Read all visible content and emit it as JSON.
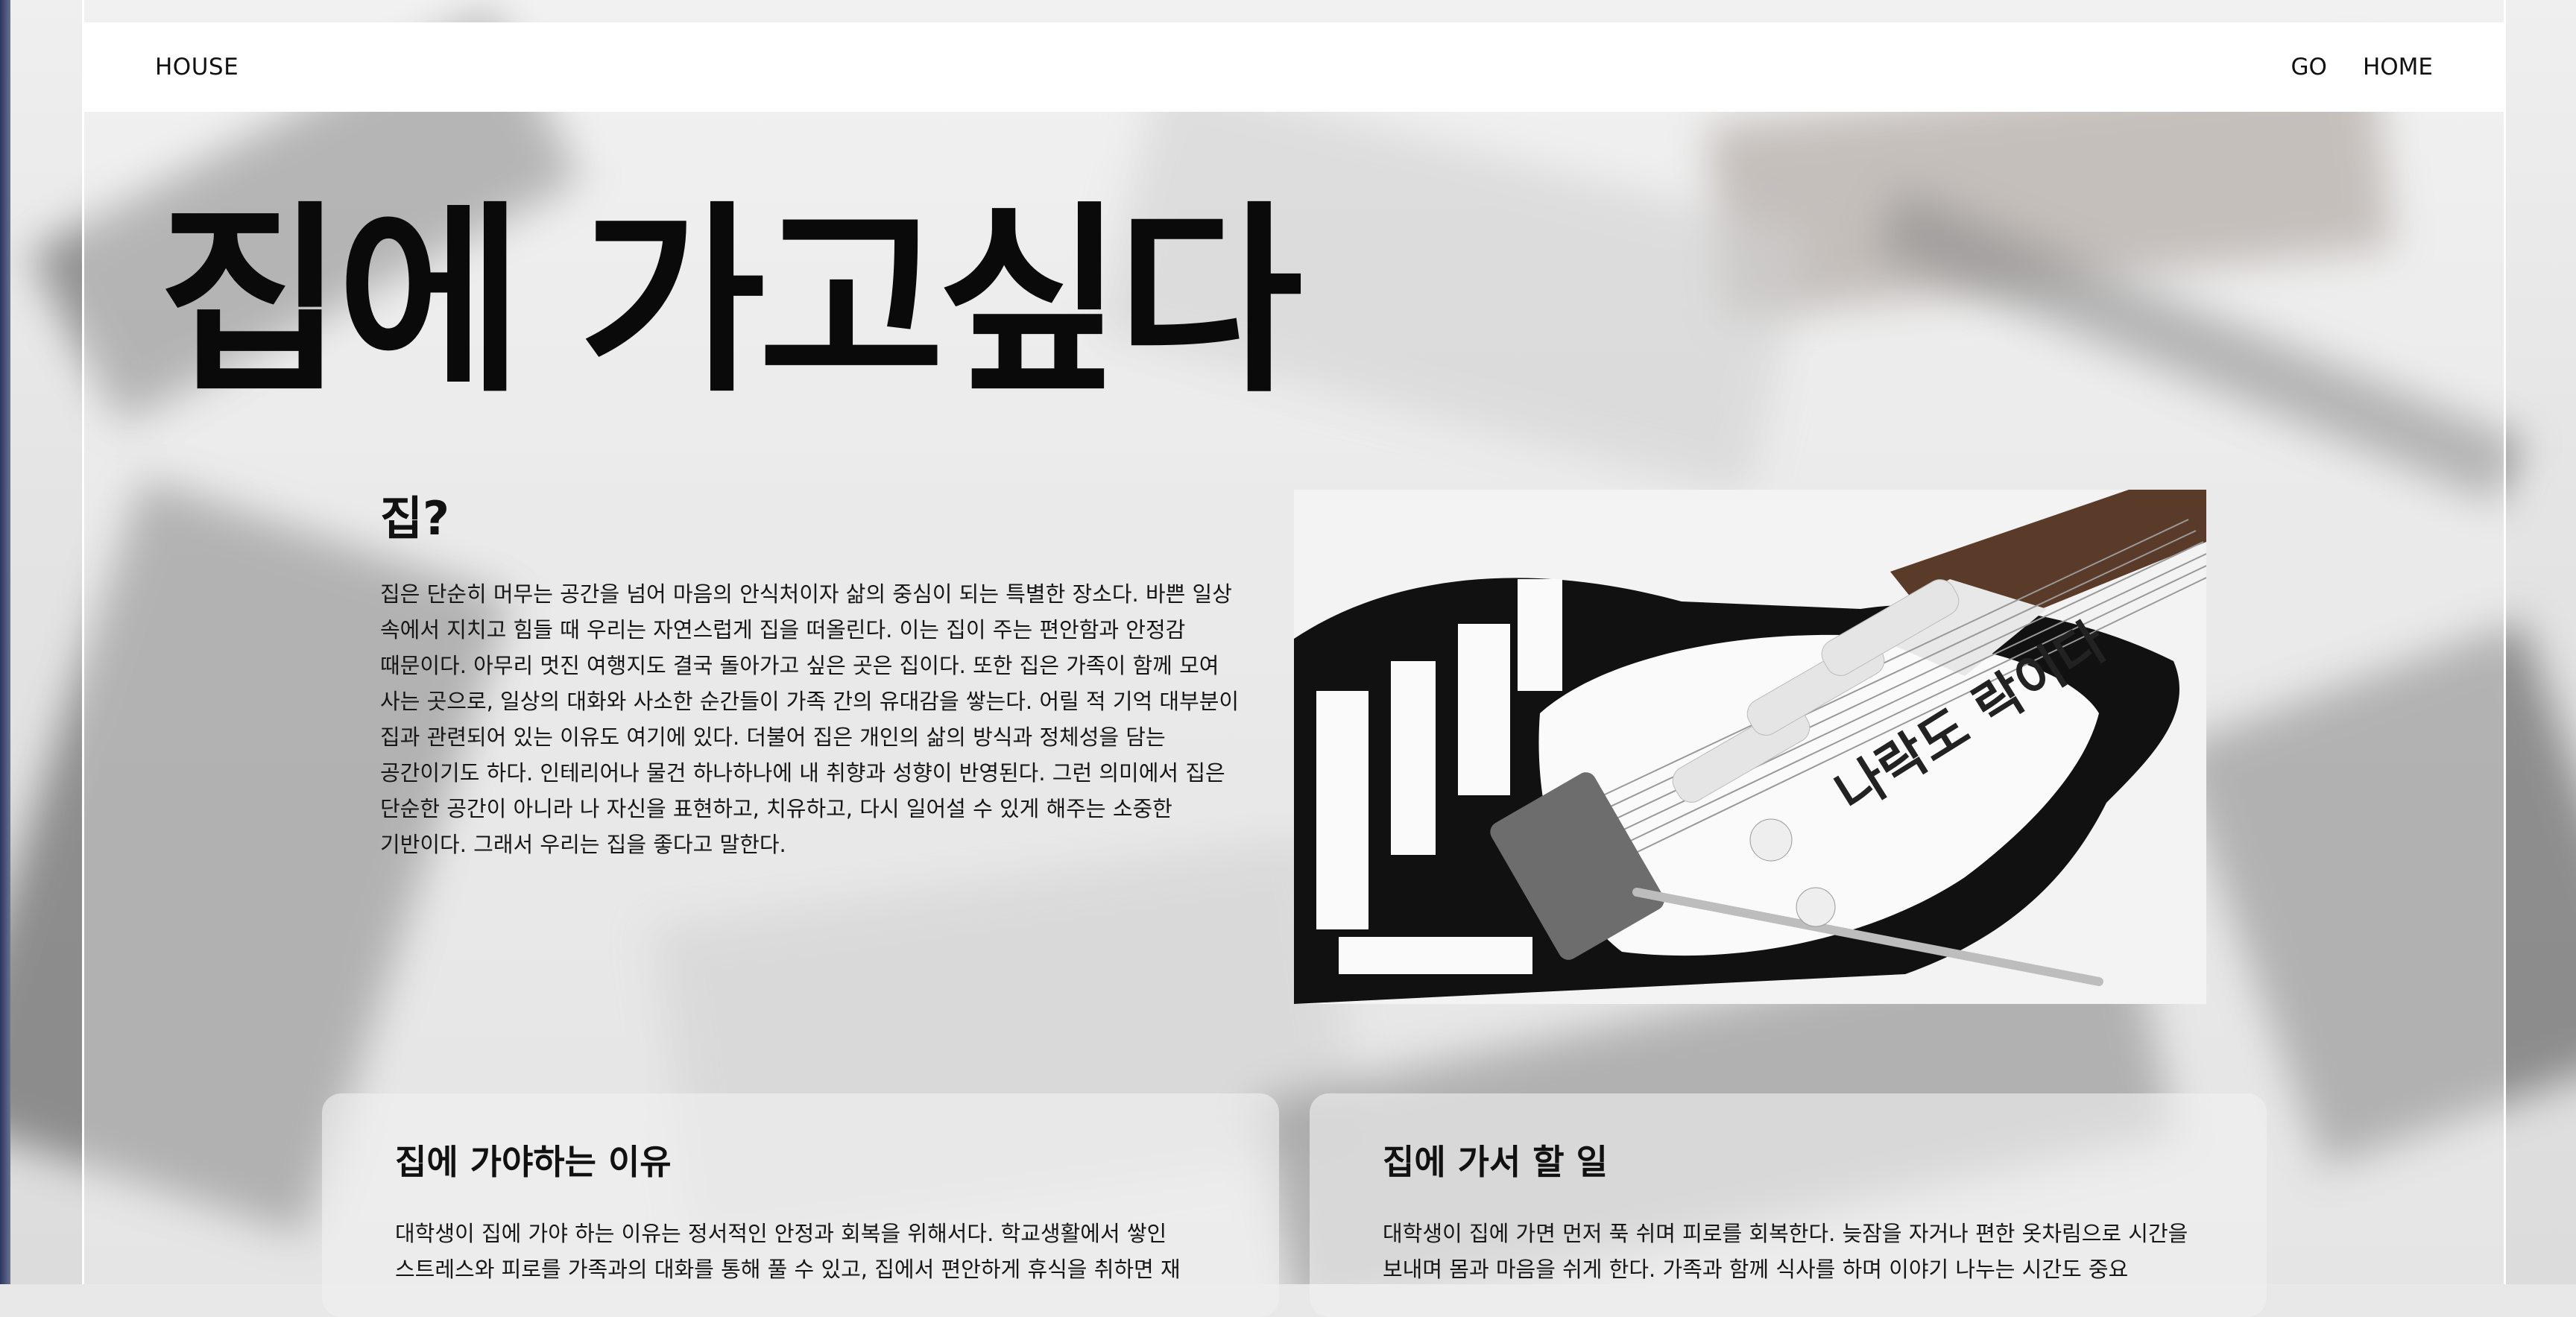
{
  "header": {
    "brand": "HOUSE",
    "nav": [
      "GO",
      "HOME"
    ]
  },
  "hero": {
    "title": "집에 가고싶다"
  },
  "intro": {
    "heading": "집?",
    "body": "집은 단순히 머무는 공간을 넘어 마음의 안식처이자 삶의 중심이 되는 특별한 장소다. 바쁜 일상 속에서 지치고 힘들 때 우리는 자연스럽게 집을 떠올린다. 이는 집이 주는 편안함과 안정감 때문이다. 아무리 멋진 여행지도 결국 돌아가고 싶은 곳은 집이다. 또한 집은 가족이 함께 모여 사는 곳으로, 일상의 대화와 사소한 순간들이 가족 간의 유대감을 쌓는다. 어릴 적 기억 대부분이 집과 관련되어 있는 이유도 여기에 있다. 더불어 집은 개인의 삶의 방식과 정체성을 담는 공간이기도 하다. 인테리어나 물건 하나하나에 내 취향과 성향이 반영된다. 그런 의미에서 집은 단순한 공간이 아니라 나 자신을 표현하고, 치유하고, 다시 일어설 수 있게 해주는 소중한 기반이다. 그래서 우리는 집을 좋다고 말한다.",
    "image_text": "나락도 락이다"
  },
  "cards": [
    {
      "title": "집에 가야하는 이유",
      "body": "대학생이 집에 가야 하는 이유는 정서적인 안정과 회복을 위해서다. 학교생활에서 쌓인 스트레스와 피로를 가족과의 대화를 통해 풀 수 있고, 집에서 편안하게 휴식을 취하면 재"
    },
    {
      "title": "집에 가서 할 일",
      "body": "대학생이 집에 가면 먼저 푹 쉬며 피로를 회복한다. 늦잠을 자거나 편한 옷차림으로 시간을 보내며 몸과 마음을 쉬게 한다. 가족과 함께 식사를 하며 이야기 나누는 시간도 중요"
    }
  ],
  "colors": {
    "topbar": "#ffffff",
    "text": "#111111",
    "card": "#f0f0f0"
  }
}
